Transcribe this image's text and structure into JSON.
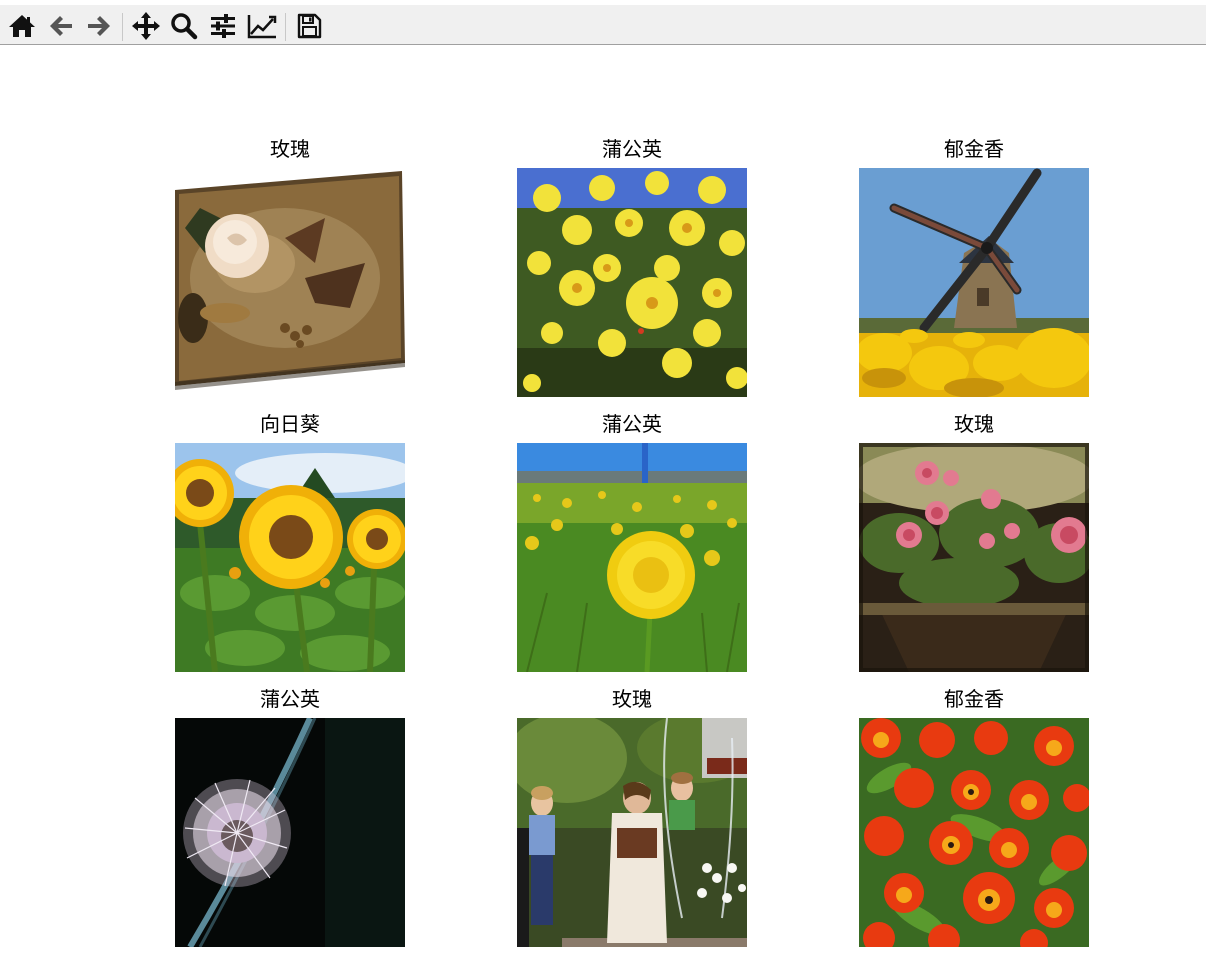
{
  "toolbar": {
    "buttons": [
      {
        "name": "home",
        "icon": "home-icon",
        "tooltip": "Reset original view"
      },
      {
        "name": "back",
        "icon": "arrow-left-icon",
        "tooltip": "Back to previous view"
      },
      {
        "name": "forward",
        "icon": "arrow-right-icon",
        "tooltip": "Forward to next view"
      },
      {
        "name": "pan",
        "icon": "move-icon",
        "tooltip": "Pan axes"
      },
      {
        "name": "zoom",
        "icon": "magnifier-icon",
        "tooltip": "Zoom to rectangle"
      },
      {
        "name": "subplots",
        "icon": "sliders-icon",
        "tooltip": "Configure subplots"
      },
      {
        "name": "customize",
        "icon": "line-chart-icon",
        "tooltip": "Edit axis, curve and image parameters"
      },
      {
        "name": "save",
        "icon": "floppy-disk-icon",
        "tooltip": "Save the figure"
      }
    ]
  },
  "grid": {
    "rows": 3,
    "cols": 3,
    "cells": [
      {
        "title": "玫瑰",
        "image": "vintage-white-rose"
      },
      {
        "title": "蒲公英",
        "image": "yellow-daisy-field"
      },
      {
        "title": "郁金香",
        "image": "windmill-tulips"
      },
      {
        "title": "向日葵",
        "image": "sunflowers"
      },
      {
        "title": "蒲公英",
        "image": "dandelion-meadow"
      },
      {
        "title": "玫瑰",
        "image": "rose-bouquet"
      },
      {
        "title": "蒲公英",
        "image": "dandelion-seedhead"
      },
      {
        "title": "玫瑰",
        "image": "family-fountain"
      },
      {
        "title": "郁金香",
        "image": "orange-tulips"
      }
    ]
  },
  "colors": {
    "toolbar_bg": "#f0f0f0",
    "icon": "#111111",
    "icon_muted": "#555555"
  }
}
